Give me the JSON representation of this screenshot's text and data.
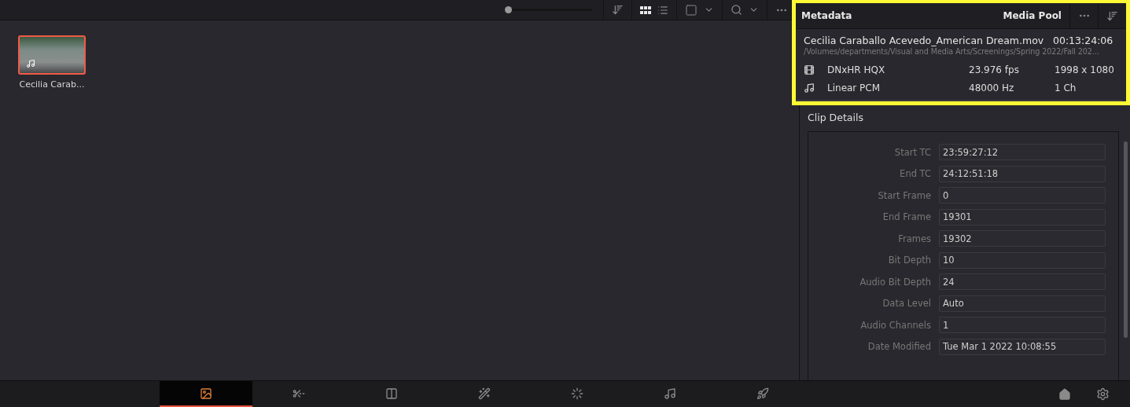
{
  "browser_toolbar": {
    "zoom": {
      "level": 0.03
    },
    "view_buttons": [
      {
        "kind": "grid",
        "selected": true
      },
      {
        "kind": "list",
        "selected": false
      }
    ]
  },
  "clips": [
    {
      "name": "Cecilia Carab...",
      "selected": true
    }
  ],
  "metadata": {
    "title": "Metadata",
    "source": "Media Pool",
    "file_name": "Cecilia Caraballo Acevedo_American Dream.mov",
    "duration": "00:13:24:06",
    "path": "/Volumes/departments/Visual and Media Arts/Screenings/Spring 2022/Fall 202...",
    "streams": [
      {
        "kind": "video",
        "codec": "DNxHR HQX",
        "rate": "23.976 fps",
        "detail": "1998 x 1080"
      },
      {
        "kind": "audio",
        "codec": "Linear PCM",
        "rate": "48000 Hz",
        "detail": "1 Ch"
      }
    ]
  },
  "clip_details": {
    "title": "Clip Details",
    "fields": [
      {
        "label": "Start TC",
        "value": "23:59:27:12"
      },
      {
        "label": "End TC",
        "value": "24:12:51:18"
      },
      {
        "label": "Start Frame",
        "value": "0"
      },
      {
        "label": "End Frame",
        "value": "19301"
      },
      {
        "label": "Frames",
        "value": "19302"
      },
      {
        "label": "Bit Depth",
        "value": "10"
      },
      {
        "label": "Audio Bit Depth",
        "value": "24"
      },
      {
        "label": "Data Level",
        "value": "Auto"
      },
      {
        "label": "Audio Channels",
        "value": "1"
      },
      {
        "label": "Date Modified",
        "value": "Tue Mar 1 2022 10:08:55"
      }
    ]
  },
  "page_tabs": [
    {
      "kind": "media",
      "selected": true
    },
    {
      "kind": "cut",
      "selected": false
    },
    {
      "kind": "edit",
      "selected": false
    },
    {
      "kind": "fusion",
      "selected": false
    },
    {
      "kind": "color",
      "selected": false
    },
    {
      "kind": "fairlight",
      "selected": false
    },
    {
      "kind": "deliver",
      "selected": false
    }
  ]
}
